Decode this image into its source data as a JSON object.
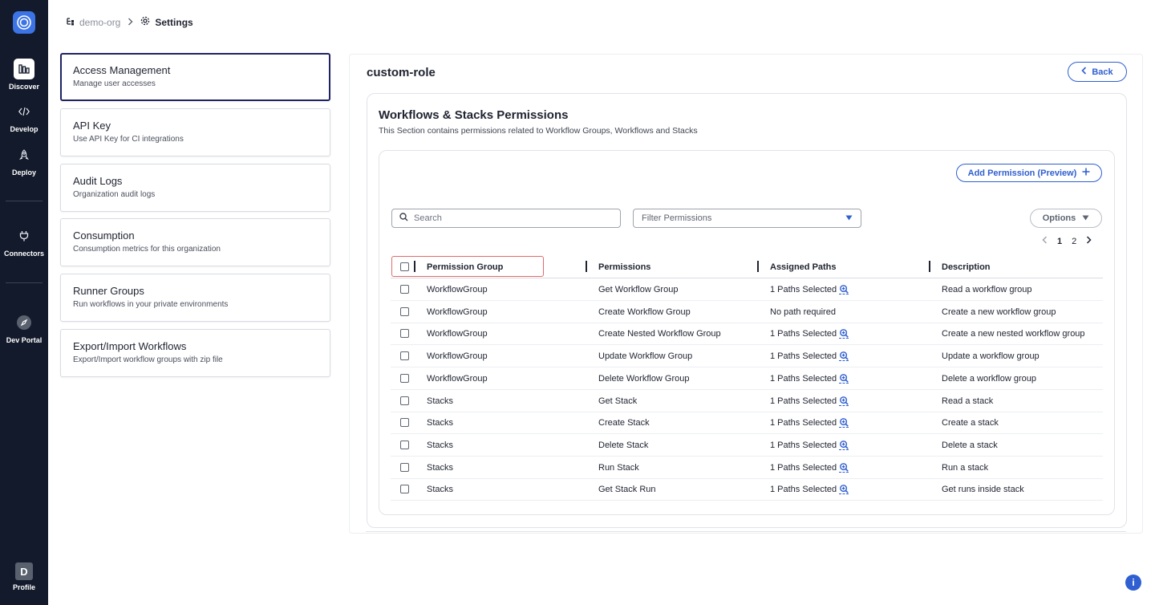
{
  "nav": {
    "items": [
      {
        "label": "Discover",
        "icon": "discover-icon"
      },
      {
        "label": "Develop",
        "icon": "code-icon"
      },
      {
        "label": "Deploy",
        "icon": "rocket-icon"
      },
      {
        "label": "Connectors",
        "icon": "plug-icon"
      },
      {
        "label": "Dev Portal",
        "icon": "portal-icon"
      }
    ],
    "profile": {
      "initial": "D",
      "label": "Profile"
    }
  },
  "breadcrumb": {
    "org": "demo-org",
    "current": "Settings"
  },
  "settings_menu": [
    {
      "title": "Access Management",
      "subtitle": "Manage user accesses"
    },
    {
      "title": "API Key",
      "subtitle": "Use API Key for CI integrations"
    },
    {
      "title": "Audit Logs",
      "subtitle": "Organization audit logs"
    },
    {
      "title": "Consumption",
      "subtitle": "Consumption metrics for this organization"
    },
    {
      "title": "Runner Groups",
      "subtitle": "Run workflows in your private environments"
    },
    {
      "title": "Export/Import Workflows",
      "subtitle": "Export/Import workflow groups with zip file"
    }
  ],
  "role": {
    "name": "custom-role",
    "back_label": "Back"
  },
  "section": {
    "title": "Workflows & Stacks Permissions",
    "description": "This Section contains permissions related to Workflow Groups, Workflows and Stacks",
    "add_permission_label": "Add Permission (Preview)",
    "search_placeholder": "Search",
    "filter_placeholder": "Filter Permissions",
    "options_label": "Options",
    "pages": [
      "1",
      "2"
    ],
    "current_page": "1"
  },
  "table": {
    "headers": [
      "Permission Group",
      "Permissions",
      "Assigned Paths",
      "Description"
    ],
    "rows": [
      {
        "group": "WorkflowGroup",
        "permission": "Get Workflow Group",
        "paths": "1 Paths Selected",
        "has_zoom": true,
        "description": "Read a workflow group"
      },
      {
        "group": "WorkflowGroup",
        "permission": "Create Workflow Group",
        "paths": "No path required",
        "has_zoom": false,
        "description": "Create a new workflow group"
      },
      {
        "group": "WorkflowGroup",
        "permission": "Create Nested Workflow Group",
        "paths": "1 Paths Selected",
        "has_zoom": true,
        "description": "Create a new nested workflow group"
      },
      {
        "group": "WorkflowGroup",
        "permission": "Update Workflow Group",
        "paths": "1 Paths Selected",
        "has_zoom": true,
        "description": "Update a workflow group"
      },
      {
        "group": "WorkflowGroup",
        "permission": "Delete Workflow Group",
        "paths": "1 Paths Selected",
        "has_zoom": true,
        "description": "Delete a workflow group"
      },
      {
        "group": "Stacks",
        "permission": "Get Stack",
        "paths": "1 Paths Selected",
        "has_zoom": true,
        "description": "Read a stack"
      },
      {
        "group": "Stacks",
        "permission": "Create Stack",
        "paths": "1 Paths Selected",
        "has_zoom": true,
        "description": "Create a stack"
      },
      {
        "group": "Stacks",
        "permission": "Delete Stack",
        "paths": "1 Paths Selected",
        "has_zoom": true,
        "description": "Delete a stack"
      },
      {
        "group": "Stacks",
        "permission": "Run Stack",
        "paths": "1 Paths Selected",
        "has_zoom": true,
        "description": "Run a stack"
      },
      {
        "group": "Stacks",
        "permission": "Get Stack Run",
        "paths": "1 Paths Selected",
        "has_zoom": true,
        "description": "Get runs inside stack"
      }
    ]
  },
  "colors": {
    "accent": "#2f5fd0",
    "nav_bg": "#131a2b",
    "active_border": "#1f2363",
    "highlight": "#e06b6b"
  },
  "info_button": {
    "icon": "info-icon",
    "glyph": "i"
  }
}
